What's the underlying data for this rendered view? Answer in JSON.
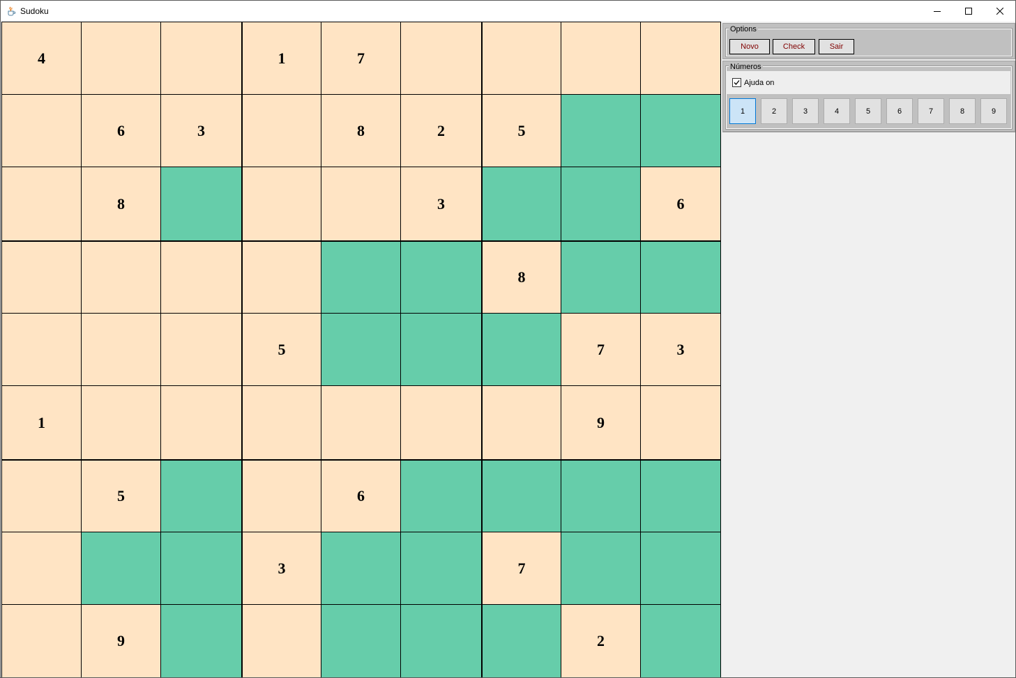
{
  "window": {
    "title": "Sudoku",
    "icon": "java-cup-icon"
  },
  "window_controls": {
    "minimize": "minimize-icon",
    "maximize": "maximize-icon",
    "close": "close-icon"
  },
  "colors": {
    "given_cell": "#ffe4c4",
    "hint_cell": "#66cdaa",
    "grid_line": "#000000",
    "option_text": "#800000"
  },
  "board": {
    "values": [
      [
        "4",
        "",
        "",
        "1",
        "7",
        "",
        "",
        "",
        ""
      ],
      [
        "",
        "6",
        "3",
        "",
        "8",
        "2",
        "5",
        "",
        ""
      ],
      [
        "",
        "8",
        "",
        "",
        "",
        "3",
        "",
        "",
        "6"
      ],
      [
        "",
        "",
        "",
        "",
        "",
        "",
        "8",
        "",
        ""
      ],
      [
        "",
        "",
        "",
        "5",
        "",
        "",
        "",
        "7",
        "3"
      ],
      [
        "1",
        "",
        "",
        "",
        "",
        "",
        "",
        "9",
        ""
      ],
      [
        "",
        "5",
        "",
        "",
        "6",
        "",
        "",
        "",
        ""
      ],
      [
        "",
        "",
        "",
        "3",
        "",
        "",
        "7",
        "",
        ""
      ],
      [
        "",
        "9",
        "",
        "",
        "",
        "",
        "",
        "2",
        ""
      ]
    ],
    "highlight": [
      [
        0,
        0,
        0,
        0,
        0,
        0,
        0,
        0,
        0
      ],
      [
        0,
        0,
        0,
        0,
        0,
        0,
        0,
        1,
        1
      ],
      [
        0,
        0,
        1,
        0,
        0,
        0,
        1,
        1,
        0
      ],
      [
        0,
        0,
        0,
        0,
        1,
        1,
        0,
        1,
        1
      ],
      [
        0,
        0,
        0,
        0,
        1,
        1,
        1,
        0,
        0
      ],
      [
        0,
        0,
        0,
        0,
        0,
        0,
        0,
        0,
        0
      ],
      [
        0,
        0,
        1,
        0,
        0,
        1,
        1,
        1,
        1
      ],
      [
        0,
        1,
        1,
        0,
        1,
        1,
        0,
        1,
        1
      ],
      [
        0,
        0,
        1,
        0,
        1,
        1,
        1,
        0,
        1
      ]
    ]
  },
  "options": {
    "legend": "Options",
    "buttons": [
      "Novo",
      "Check",
      "Sair"
    ]
  },
  "numbers": {
    "legend": "Números",
    "help_label": "Ajuda on",
    "help_checked": true,
    "buttons": [
      "1",
      "2",
      "3",
      "4",
      "5",
      "6",
      "7",
      "8",
      "9"
    ],
    "selected": "1"
  }
}
